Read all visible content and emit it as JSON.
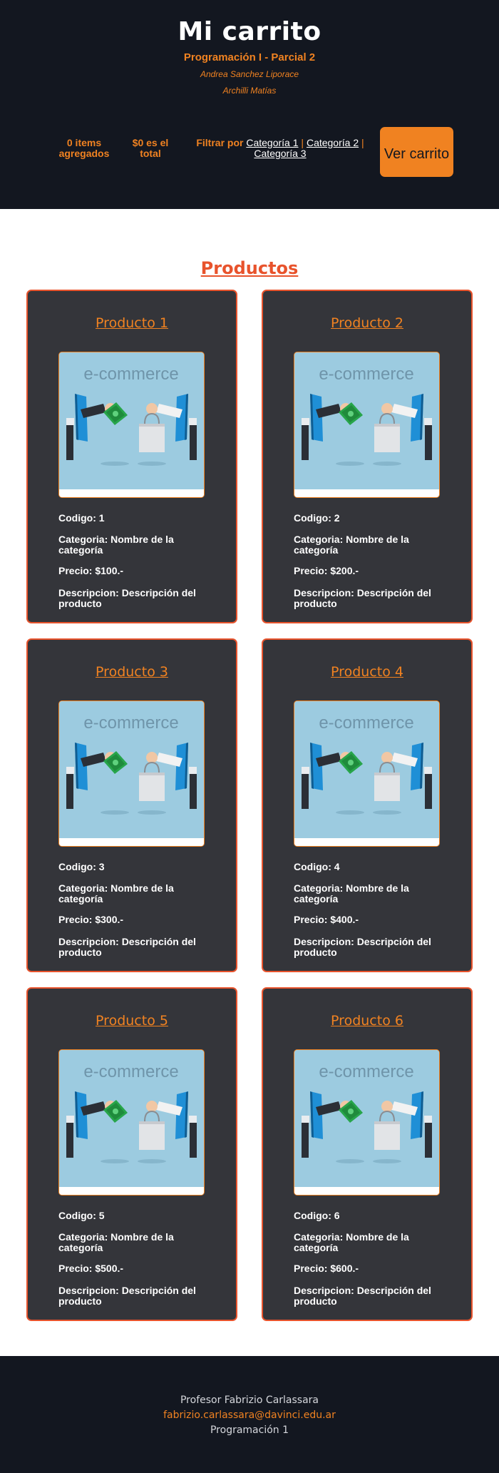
{
  "header": {
    "title": "Mi carrito",
    "subtitle": "Programación I - Parcial 2",
    "authors": [
      "Andrea Sanchez Liporace",
      "Archilli Matías"
    ],
    "items_count": "0 items agregados",
    "total": "$0 es el total",
    "filter_label": "Filtrar por",
    "categories": [
      "Categoría 1",
      "Categoría 2",
      "Categoría 3"
    ],
    "separator": "|",
    "cart_button": "Ver carrito"
  },
  "products_section": {
    "title": "Productos",
    "image_caption": "e-commerce",
    "items": [
      {
        "title": "Producto 1",
        "code": "Codigo: 1",
        "category": "Categoria: Nombre de la categoría",
        "price": "Precio: $100.-",
        "description": "Descripcion: Descripción del producto"
      },
      {
        "title": "Producto 2",
        "code": "Codigo: 2",
        "category": "Categoria: Nombre de la categoría",
        "price": "Precio: $200.-",
        "description": "Descripcion: Descripción del producto"
      },
      {
        "title": "Producto 3",
        "code": "Codigo: 3",
        "category": "Categoria: Nombre de la categoría",
        "price": "Precio: $300.-",
        "description": "Descripcion: Descripción del producto"
      },
      {
        "title": "Producto 4",
        "code": "Codigo: 4",
        "category": "Categoria: Nombre de la categoría",
        "price": "Precio: $400.-",
        "description": "Descripcion: Descripción del producto"
      },
      {
        "title": "Producto 5",
        "code": "Codigo: 5",
        "category": "Categoria: Nombre de la categoría",
        "price": "Precio: $500.-",
        "description": "Descripcion: Descripción del producto"
      },
      {
        "title": "Producto 6",
        "code": "Codigo: 6",
        "category": "Categoria: Nombre de la categoría",
        "price": "Precio: $600.-",
        "description": "Descripcion: Descripción del producto"
      }
    ]
  },
  "footer": {
    "professor": "Profesor Fabrizio Carlassara",
    "email": "fabrizio.carlassara@davinci.edu.ar",
    "course": "Programación 1"
  },
  "colors": {
    "header_bg": "#131720",
    "accent_orange": "#f08221",
    "accent_red": "#e8532c",
    "card_bg": "#34353a",
    "image_bg": "#9ccbe0"
  },
  "icons": {
    "product_image": "ecommerce-illustration"
  }
}
